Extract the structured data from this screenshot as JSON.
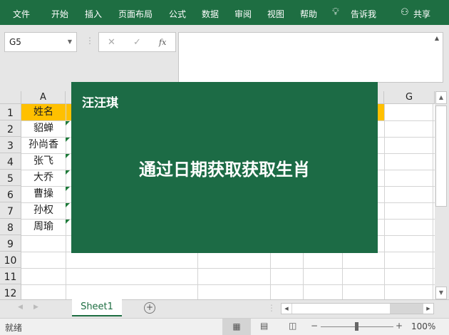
{
  "ribbon": {
    "menus": [
      "文件",
      "开始",
      "插入",
      "页面布局",
      "公式",
      "数据",
      "审阅",
      "视图",
      "帮助"
    ],
    "tell_me": "告诉我",
    "share": "共享"
  },
  "formula_bar": {
    "name_box": "G5",
    "cancel": "✕",
    "enter": "✓",
    "fx": "fx",
    "value": ""
  },
  "columns": [
    "A",
    "G"
  ],
  "rows": [
    "1",
    "2",
    "3",
    "4",
    "5",
    "6",
    "7",
    "8",
    "9",
    "10",
    "11",
    "12"
  ],
  "column_a": [
    "姓名",
    "貂蝉",
    "孙尚香",
    "张飞",
    "大乔",
    "曹操",
    "孙权",
    "周瑜"
  ],
  "overlay": {
    "author": "汪汪琪",
    "title": "通过日期获取获取生肖"
  },
  "sheets": {
    "tabs": [
      "Sheet1"
    ],
    "add": "+"
  },
  "status": {
    "text": "就绪",
    "zoom": "100%",
    "minus": "−",
    "plus": "+"
  },
  "colors": {
    "ribbon": "#1e6e42",
    "header_fill": "#ffc000",
    "overlay": "#1c6b45"
  }
}
